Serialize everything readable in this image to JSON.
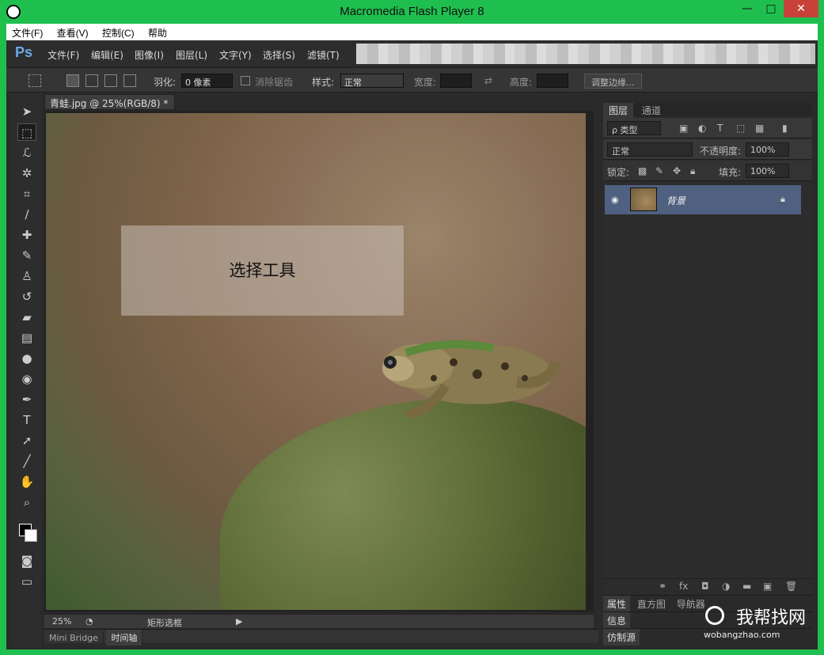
{
  "window": {
    "title": "Macromedia Flash Player 8",
    "min": "—",
    "max": "□",
    "close": "✕"
  },
  "flash_menu": [
    "文件(F)",
    "查看(V)",
    "控制(C)",
    "帮助"
  ],
  "ps": {
    "logo": "Ps",
    "menu": [
      "文件(F)",
      "编辑(E)",
      "图像(I)",
      "图层(L)",
      "文字(Y)",
      "选择(S)",
      "滤镜(T)"
    ]
  },
  "options": {
    "feather_label": "羽化:",
    "feather_value": "0 像素",
    "antialias_label": "消除锯齿",
    "style_label": "样式:",
    "style_value": "正常",
    "width_label": "宽度:",
    "height_label": "高度:",
    "refine_button": "调整边缘..."
  },
  "document": {
    "tab": "青蛙.jpg @ 25%(RGB/8) *",
    "tab_close": "×",
    "overlay_text": "选择工具"
  },
  "status": {
    "zoom": "25%",
    "info": "矩形选框"
  },
  "bottom_tabs": [
    "Mini Bridge",
    "时间轴"
  ],
  "layers_panel": {
    "tabs": [
      "图层",
      "通道"
    ],
    "filter_label": "ρ 类型",
    "blend_mode": "正常",
    "opacity_label": "不透明度:",
    "opacity_value": "100%",
    "lock_label": "锁定:",
    "fill_label": "填充:",
    "fill_value": "100%",
    "layer_name": "背景"
  },
  "lower_panels": {
    "row1": [
      "属性",
      "直方图",
      "导航器"
    ],
    "row2": [
      "信息"
    ],
    "row3": [
      "仿制源"
    ]
  },
  "watermark": {
    "cn": "我帮找网",
    "url": "wobangzhao.com"
  }
}
